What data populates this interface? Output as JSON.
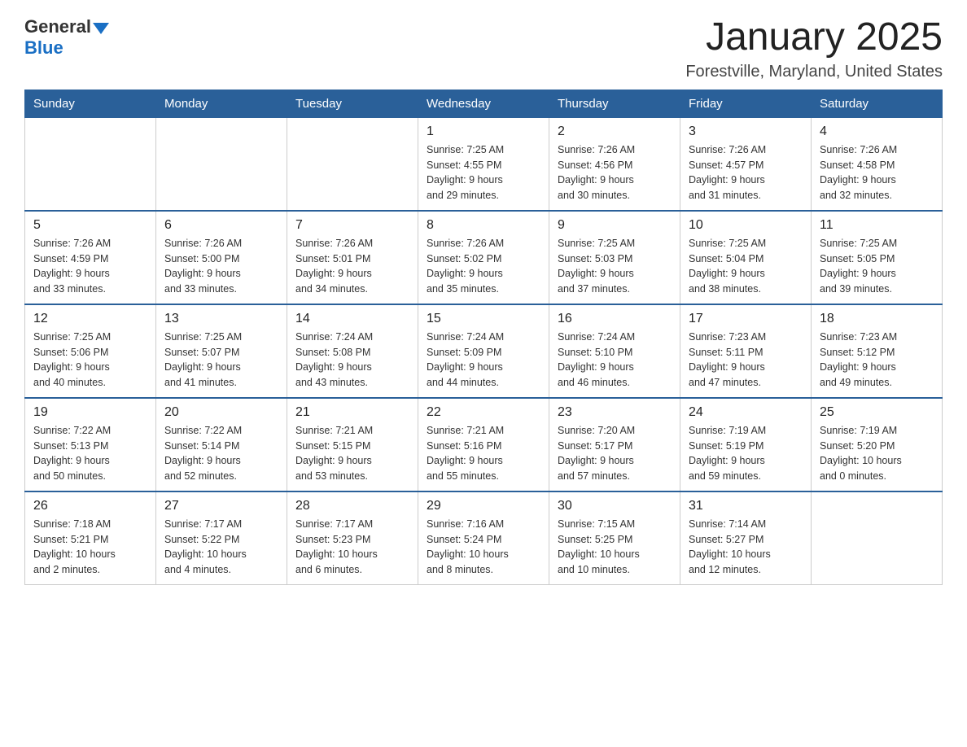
{
  "header": {
    "logo_general": "General",
    "logo_blue": "Blue",
    "month_title": "January 2025",
    "location": "Forestville, Maryland, United States"
  },
  "days_of_week": [
    "Sunday",
    "Monday",
    "Tuesday",
    "Wednesday",
    "Thursday",
    "Friday",
    "Saturday"
  ],
  "weeks": [
    [
      {
        "day": "",
        "info": ""
      },
      {
        "day": "",
        "info": ""
      },
      {
        "day": "",
        "info": ""
      },
      {
        "day": "1",
        "info": "Sunrise: 7:25 AM\nSunset: 4:55 PM\nDaylight: 9 hours\nand 29 minutes."
      },
      {
        "day": "2",
        "info": "Sunrise: 7:26 AM\nSunset: 4:56 PM\nDaylight: 9 hours\nand 30 minutes."
      },
      {
        "day": "3",
        "info": "Sunrise: 7:26 AM\nSunset: 4:57 PM\nDaylight: 9 hours\nand 31 minutes."
      },
      {
        "day": "4",
        "info": "Sunrise: 7:26 AM\nSunset: 4:58 PM\nDaylight: 9 hours\nand 32 minutes."
      }
    ],
    [
      {
        "day": "5",
        "info": "Sunrise: 7:26 AM\nSunset: 4:59 PM\nDaylight: 9 hours\nand 33 minutes."
      },
      {
        "day": "6",
        "info": "Sunrise: 7:26 AM\nSunset: 5:00 PM\nDaylight: 9 hours\nand 33 minutes."
      },
      {
        "day": "7",
        "info": "Sunrise: 7:26 AM\nSunset: 5:01 PM\nDaylight: 9 hours\nand 34 minutes."
      },
      {
        "day": "8",
        "info": "Sunrise: 7:26 AM\nSunset: 5:02 PM\nDaylight: 9 hours\nand 35 minutes."
      },
      {
        "day": "9",
        "info": "Sunrise: 7:25 AM\nSunset: 5:03 PM\nDaylight: 9 hours\nand 37 minutes."
      },
      {
        "day": "10",
        "info": "Sunrise: 7:25 AM\nSunset: 5:04 PM\nDaylight: 9 hours\nand 38 minutes."
      },
      {
        "day": "11",
        "info": "Sunrise: 7:25 AM\nSunset: 5:05 PM\nDaylight: 9 hours\nand 39 minutes."
      }
    ],
    [
      {
        "day": "12",
        "info": "Sunrise: 7:25 AM\nSunset: 5:06 PM\nDaylight: 9 hours\nand 40 minutes."
      },
      {
        "day": "13",
        "info": "Sunrise: 7:25 AM\nSunset: 5:07 PM\nDaylight: 9 hours\nand 41 minutes."
      },
      {
        "day": "14",
        "info": "Sunrise: 7:24 AM\nSunset: 5:08 PM\nDaylight: 9 hours\nand 43 minutes."
      },
      {
        "day": "15",
        "info": "Sunrise: 7:24 AM\nSunset: 5:09 PM\nDaylight: 9 hours\nand 44 minutes."
      },
      {
        "day": "16",
        "info": "Sunrise: 7:24 AM\nSunset: 5:10 PM\nDaylight: 9 hours\nand 46 minutes."
      },
      {
        "day": "17",
        "info": "Sunrise: 7:23 AM\nSunset: 5:11 PM\nDaylight: 9 hours\nand 47 minutes."
      },
      {
        "day": "18",
        "info": "Sunrise: 7:23 AM\nSunset: 5:12 PM\nDaylight: 9 hours\nand 49 minutes."
      }
    ],
    [
      {
        "day": "19",
        "info": "Sunrise: 7:22 AM\nSunset: 5:13 PM\nDaylight: 9 hours\nand 50 minutes."
      },
      {
        "day": "20",
        "info": "Sunrise: 7:22 AM\nSunset: 5:14 PM\nDaylight: 9 hours\nand 52 minutes."
      },
      {
        "day": "21",
        "info": "Sunrise: 7:21 AM\nSunset: 5:15 PM\nDaylight: 9 hours\nand 53 minutes."
      },
      {
        "day": "22",
        "info": "Sunrise: 7:21 AM\nSunset: 5:16 PM\nDaylight: 9 hours\nand 55 minutes."
      },
      {
        "day": "23",
        "info": "Sunrise: 7:20 AM\nSunset: 5:17 PM\nDaylight: 9 hours\nand 57 minutes."
      },
      {
        "day": "24",
        "info": "Sunrise: 7:19 AM\nSunset: 5:19 PM\nDaylight: 9 hours\nand 59 minutes."
      },
      {
        "day": "25",
        "info": "Sunrise: 7:19 AM\nSunset: 5:20 PM\nDaylight: 10 hours\nand 0 minutes."
      }
    ],
    [
      {
        "day": "26",
        "info": "Sunrise: 7:18 AM\nSunset: 5:21 PM\nDaylight: 10 hours\nand 2 minutes."
      },
      {
        "day": "27",
        "info": "Sunrise: 7:17 AM\nSunset: 5:22 PM\nDaylight: 10 hours\nand 4 minutes."
      },
      {
        "day": "28",
        "info": "Sunrise: 7:17 AM\nSunset: 5:23 PM\nDaylight: 10 hours\nand 6 minutes."
      },
      {
        "day": "29",
        "info": "Sunrise: 7:16 AM\nSunset: 5:24 PM\nDaylight: 10 hours\nand 8 minutes."
      },
      {
        "day": "30",
        "info": "Sunrise: 7:15 AM\nSunset: 5:25 PM\nDaylight: 10 hours\nand 10 minutes."
      },
      {
        "day": "31",
        "info": "Sunrise: 7:14 AM\nSunset: 5:27 PM\nDaylight: 10 hours\nand 12 minutes."
      },
      {
        "day": "",
        "info": ""
      }
    ]
  ]
}
